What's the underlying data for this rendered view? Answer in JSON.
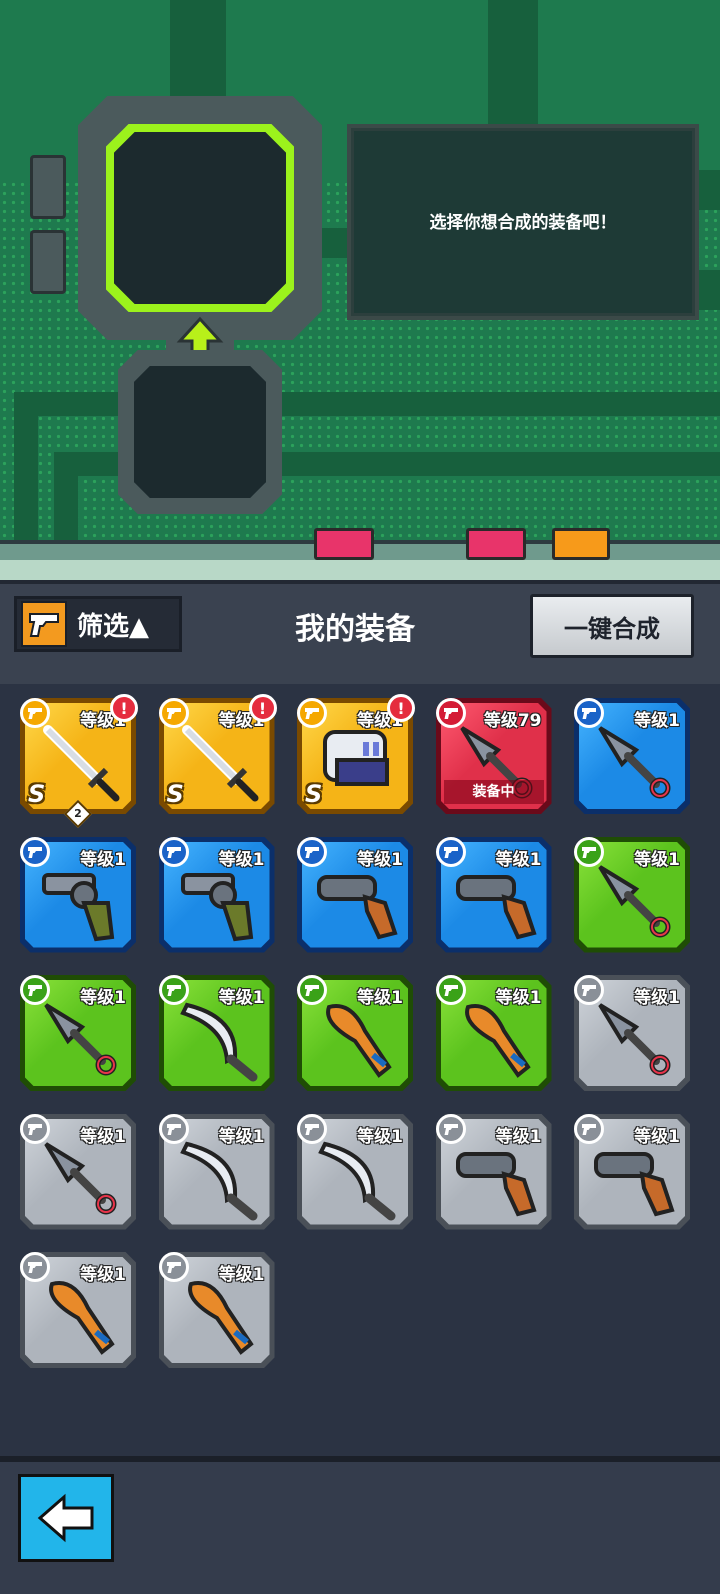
{
  "machine": {
    "message": "选择你想合成的装备吧！"
  },
  "toolbar": {
    "filter_label": "筛选▲",
    "title": "我的装备",
    "merge_label": "一键合成"
  },
  "colors": {
    "gold": "#f5b417",
    "red": "#e0304a",
    "blue": "#1c8ae6",
    "green": "#5cc31e",
    "gray": "#aeb4bc"
  },
  "items": [
    {
      "rarity": "gold",
      "level": "等级1",
      "weapon": "sword",
      "alert": "!",
      "grade": "S",
      "count": "2"
    },
    {
      "rarity": "gold",
      "level": "等级1",
      "weapon": "sword",
      "alert": "!",
      "grade": "S"
    },
    {
      "rarity": "gold",
      "level": "等级1",
      "weapon": "gauntlet",
      "alert": "!",
      "grade": "S"
    },
    {
      "rarity": "red",
      "level": "等级79",
      "weapon": "kunai",
      "status": "装备中"
    },
    {
      "rarity": "blue",
      "level": "等级1",
      "weapon": "kunai"
    },
    {
      "rarity": "blue",
      "level": "等级1",
      "weapon": "revolver"
    },
    {
      "rarity": "blue",
      "level": "等级1",
      "weapon": "revolver"
    },
    {
      "rarity": "blue",
      "level": "等级1",
      "weapon": "shotgun"
    },
    {
      "rarity": "blue",
      "level": "等级1",
      "weapon": "shotgun"
    },
    {
      "rarity": "green",
      "level": "等级1",
      "weapon": "kunai"
    },
    {
      "rarity": "green",
      "level": "等级1",
      "weapon": "kunai"
    },
    {
      "rarity": "green",
      "level": "等级1",
      "weapon": "machete"
    },
    {
      "rarity": "green",
      "level": "等级1",
      "weapon": "bat"
    },
    {
      "rarity": "green",
      "level": "等级1",
      "weapon": "bat"
    },
    {
      "rarity": "gray",
      "level": "等级1",
      "weapon": "kunai"
    },
    {
      "rarity": "gray",
      "level": "等级1",
      "weapon": "kunai"
    },
    {
      "rarity": "gray",
      "level": "等级1",
      "weapon": "machete"
    },
    {
      "rarity": "gray",
      "level": "等级1",
      "weapon": "machete"
    },
    {
      "rarity": "gray",
      "level": "等级1",
      "weapon": "shotgun"
    },
    {
      "rarity": "gray",
      "level": "等级1",
      "weapon": "shotgun"
    },
    {
      "rarity": "gray",
      "level": "等级1",
      "weapon": "bat"
    },
    {
      "rarity": "gray",
      "level": "等级1",
      "weapon": "bat"
    }
  ],
  "icons": {
    "type_icon": "gun-icon",
    "back": "back-arrow-icon"
  }
}
